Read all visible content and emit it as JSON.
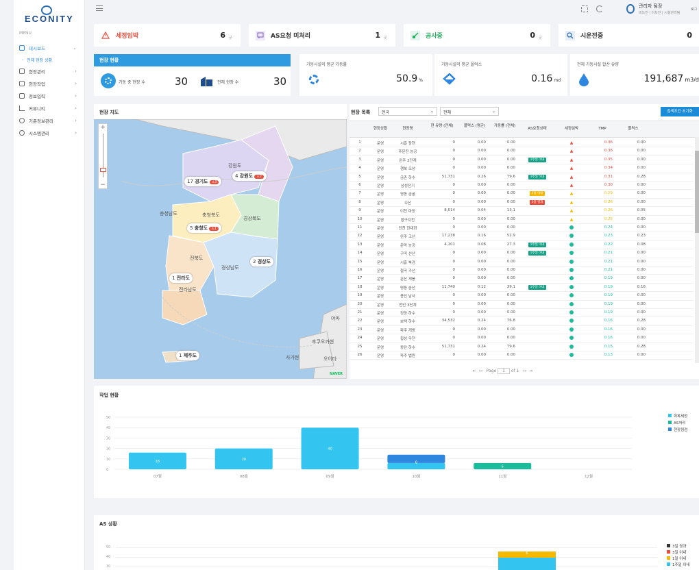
{
  "brand": {
    "logo": "ECONITY"
  },
  "menu": {
    "header": "MENU",
    "items": [
      {
        "label": "대시보드",
        "active": true
      },
      {
        "label": "전체 현장 상황",
        "sub": true
      },
      {
        "label": "현장관리"
      },
      {
        "label": "현장작업"
      },
      {
        "label": "정보입력"
      },
      {
        "label": "커뮤니티"
      },
      {
        "label": "기준정보관리"
      },
      {
        "label": "시스템관리"
      }
    ]
  },
  "user": {
    "name": "관리자 팀장",
    "sub": "버드진 | 이드진 | 시설관리팀",
    "logout": "로그"
  },
  "alerts": [
    {
      "label": "세정임박",
      "value": "6",
      "unit": "곳",
      "color": "#e74c3c",
      "icon": "warning-icon"
    },
    {
      "label": "AS요청 미처리",
      "value": "1",
      "unit": "곳",
      "color": "#333",
      "icon": "message-icon"
    },
    {
      "label": "공사중",
      "value": "0",
      "unit": "곳",
      "color": "#333",
      "icon": "construction-icon"
    },
    {
      "label": "시운전중",
      "value": "0",
      "unit": "곳",
      "color": "#333",
      "icon": "search-icon"
    }
  ],
  "status": {
    "title": "현장 현황",
    "running_label": "가동 중 현장 수",
    "running": "30",
    "total_label": "전체 현장 수",
    "total": "30"
  },
  "kpis": [
    {
      "label": "가동시설의 평균 가동률",
      "value": "50.9",
      "unit": "%",
      "icon": "gear-icon"
    },
    {
      "label": "가동시설의 평균 플럭스",
      "value": "0.16",
      "unit": "md",
      "icon": "fill-icon"
    },
    {
      "label": "전체 가동시설 합산 유량",
      "value": "191,687",
      "unit": "m3/d",
      "icon": "drop-icon"
    }
  ],
  "map": {
    "title": "현장 지도",
    "brand": "NAVER",
    "regions": [
      {
        "label": "경기도",
        "count": "17",
        "badge": "3"
      },
      {
        "label": "강원도",
        "count": "4",
        "badge": "2"
      },
      {
        "label": "충청도",
        "count": "5",
        "badge": "1"
      },
      {
        "label": "경상도",
        "count": "2",
        "badge": ""
      },
      {
        "label": "전라도",
        "count": "1",
        "badge": ""
      },
      {
        "label": "제주도",
        "count": "1",
        "badge": ""
      }
    ],
    "place_labels": [
      "강원도",
      "충청북도",
      "충청남도",
      "경상북도",
      "전북도",
      "경상남도",
      "전라남도",
      "오이타",
      "사가현",
      "후쿠오카현",
      "야마"
    ]
  },
  "list": {
    "title": "현장 목록",
    "filter1": "전국",
    "filter2": "전체",
    "reset": "검색조건 초기화",
    "headers": [
      "",
      "현장상황",
      "현장명",
      "현 유량 (전체)",
      "플럭스 (평균)",
      "가동률 (전체)",
      "AS요청상태",
      "세정임박",
      "TMP",
      "플럭스"
    ],
    "rows": [
      [
        "1",
        "운영",
        "시흥 장현",
        "0",
        "0.00",
        "0.00",
        "",
        "r",
        "0.36",
        "0.00"
      ],
      [
        "2",
        "운영",
        "추운진 농공",
        "0",
        "0.00",
        "0.00",
        "",
        "r",
        "0.36",
        "0.00"
      ],
      [
        "3",
        "운영",
        "완주 2단계",
        "0",
        "0.00",
        "0.00",
        "1주일 이내",
        "r",
        "0.35",
        "0.00"
      ],
      [
        "4",
        "운영",
        "행복 오성",
        "0",
        "0.00",
        "0.00",
        "",
        "r",
        "0.34",
        "0.00"
      ],
      [
        "5",
        "운영",
        "금촌 하수",
        "51,731",
        "0.26",
        "79.6",
        "1주일 이내",
        "r",
        "0.31",
        "0.28"
      ],
      [
        "6",
        "운영",
        "삼성전기",
        "0",
        "0.00",
        "0.00",
        "",
        "r",
        "0.30",
        "0.00"
      ],
      [
        "7",
        "운영",
        "영동 금굴",
        "0",
        "0.00",
        "0.00",
        "3일 이내",
        "y",
        "0.29",
        "0.00"
      ],
      [
        "8",
        "운영",
        "오산",
        "0",
        "0.00",
        "0.00",
        "3일 경과",
        "y",
        "0.26",
        "0.00"
      ],
      [
        "9",
        "운영",
        "이천 마장",
        "8,514",
        "0.04",
        "13.1",
        "",
        "y",
        "0.26",
        "0.05"
      ],
      [
        "10",
        "운영",
        "황구지천",
        "0",
        "0.00",
        "0.00",
        "",
        "y",
        "0.25",
        "0.00"
      ],
      [
        "11",
        "운영",
        "전천 한대화",
        "0",
        "0.00",
        "0.00",
        "",
        "g",
        "0.24",
        "0.00"
      ],
      [
        "12",
        "운영",
        "완주 고선",
        "17,238",
        "0.16",
        "52.9",
        "",
        "g",
        "0.23",
        "0.23"
      ],
      [
        "13",
        "운영",
        "문막 농공",
        "4,101",
        "0.08",
        "27.3",
        "1주일 이내",
        "g",
        "0.22",
        "0.08"
      ],
      [
        "14",
        "운영",
        "구미 선산",
        "0",
        "0.00",
        "0.00",
        "1주일 이내",
        "g",
        "0.21",
        "0.00"
      ],
      [
        "15",
        "운영",
        "시흥 북검",
        "0",
        "0.00",
        "0.00",
        "",
        "g",
        "0.21",
        "0.00"
      ],
      [
        "16",
        "운영",
        "철곡 가선",
        "0",
        "0.00",
        "0.00",
        "",
        "g",
        "0.21",
        "0.00"
      ],
      [
        "17",
        "운영",
        "문산 개봉",
        "0",
        "0.00",
        "0.00",
        "",
        "g",
        "0.19",
        "0.00"
      ],
      [
        "18",
        "운영",
        "명동 송산",
        "11,740",
        "0.12",
        "39.1",
        "1주일 이내",
        "g",
        "0.19",
        "0.16"
      ],
      [
        "19",
        "운영",
        "용인 남사",
        "0",
        "0.00",
        "0.00",
        "",
        "g",
        "0.19",
        "0.00"
      ],
      [
        "20",
        "운영",
        "천안 3단계",
        "0",
        "0.00",
        "0.00",
        "",
        "g",
        "0.19",
        "0.00"
      ],
      [
        "21",
        "운영",
        "정양 하수",
        "0",
        "0.00",
        "0.00",
        "",
        "g",
        "0.19",
        "0.00"
      ],
      [
        "22",
        "운영",
        "보택 하수",
        "34,532",
        "0.24",
        "76.8",
        "",
        "g",
        "0.16",
        "0.28"
      ],
      [
        "23",
        "운영",
        "파주 개방",
        "0",
        "0.00",
        "0.00",
        "",
        "g",
        "0.16",
        "0.00"
      ],
      [
        "24",
        "운영",
        "횡성 우천",
        "0",
        "0.00",
        "0.00",
        "",
        "g",
        "0.16",
        "0.00"
      ],
      [
        "25",
        "운영",
        "동탄 하수",
        "51,731",
        "0.24",
        "79.6",
        "",
        "g",
        "0.15",
        "0.28"
      ],
      [
        "26",
        "운영",
        "파주 법원",
        "0",
        "0.00",
        "0.00",
        "",
        "g",
        "0.13",
        "0.00"
      ]
    ],
    "pager": {
      "page_label": "Page",
      "page": "1",
      "of": "of 1"
    }
  },
  "work": {
    "title": "작업 현황",
    "chart_data": {
      "type": "bar",
      "categories": [
        "07월",
        "08월",
        "09월",
        "10월",
        "11월",
        "12월"
      ],
      "yticks": [
        "50",
        "40",
        "30",
        "20",
        "10",
        "0"
      ],
      "ylim": [
        0,
        50
      ],
      "series": [
        {
          "name": "회복세정",
          "color": "#33c5f0",
          "values": [
            16,
            20,
            40,
            6,
            0,
            0
          ]
        },
        {
          "name": "AS처리",
          "color": "#1abc9c",
          "values": [
            0,
            0,
            0,
            0,
            6,
            0
          ]
        },
        {
          "name": "현장점검",
          "color": "#2e86de",
          "values": [
            0,
            0,
            0,
            8,
            0,
            0
          ]
        }
      ],
      "bar_labels": [
        "16",
        "20",
        "40",
        "8",
        "6",
        ""
      ]
    }
  },
  "as": {
    "title": "AS 상황",
    "yticks": [
      "50",
      "40",
      "30"
    ],
    "legend": [
      {
        "label": "3일 경과",
        "color": "#333"
      },
      {
        "label": "3일 이내",
        "color": "#e74c3c"
      },
      {
        "label": "1일 이내",
        "color": "#f5b800"
      },
      {
        "label": "1주일 이내",
        "color": "#33c5f0"
      }
    ],
    "bar_label": "6"
  }
}
